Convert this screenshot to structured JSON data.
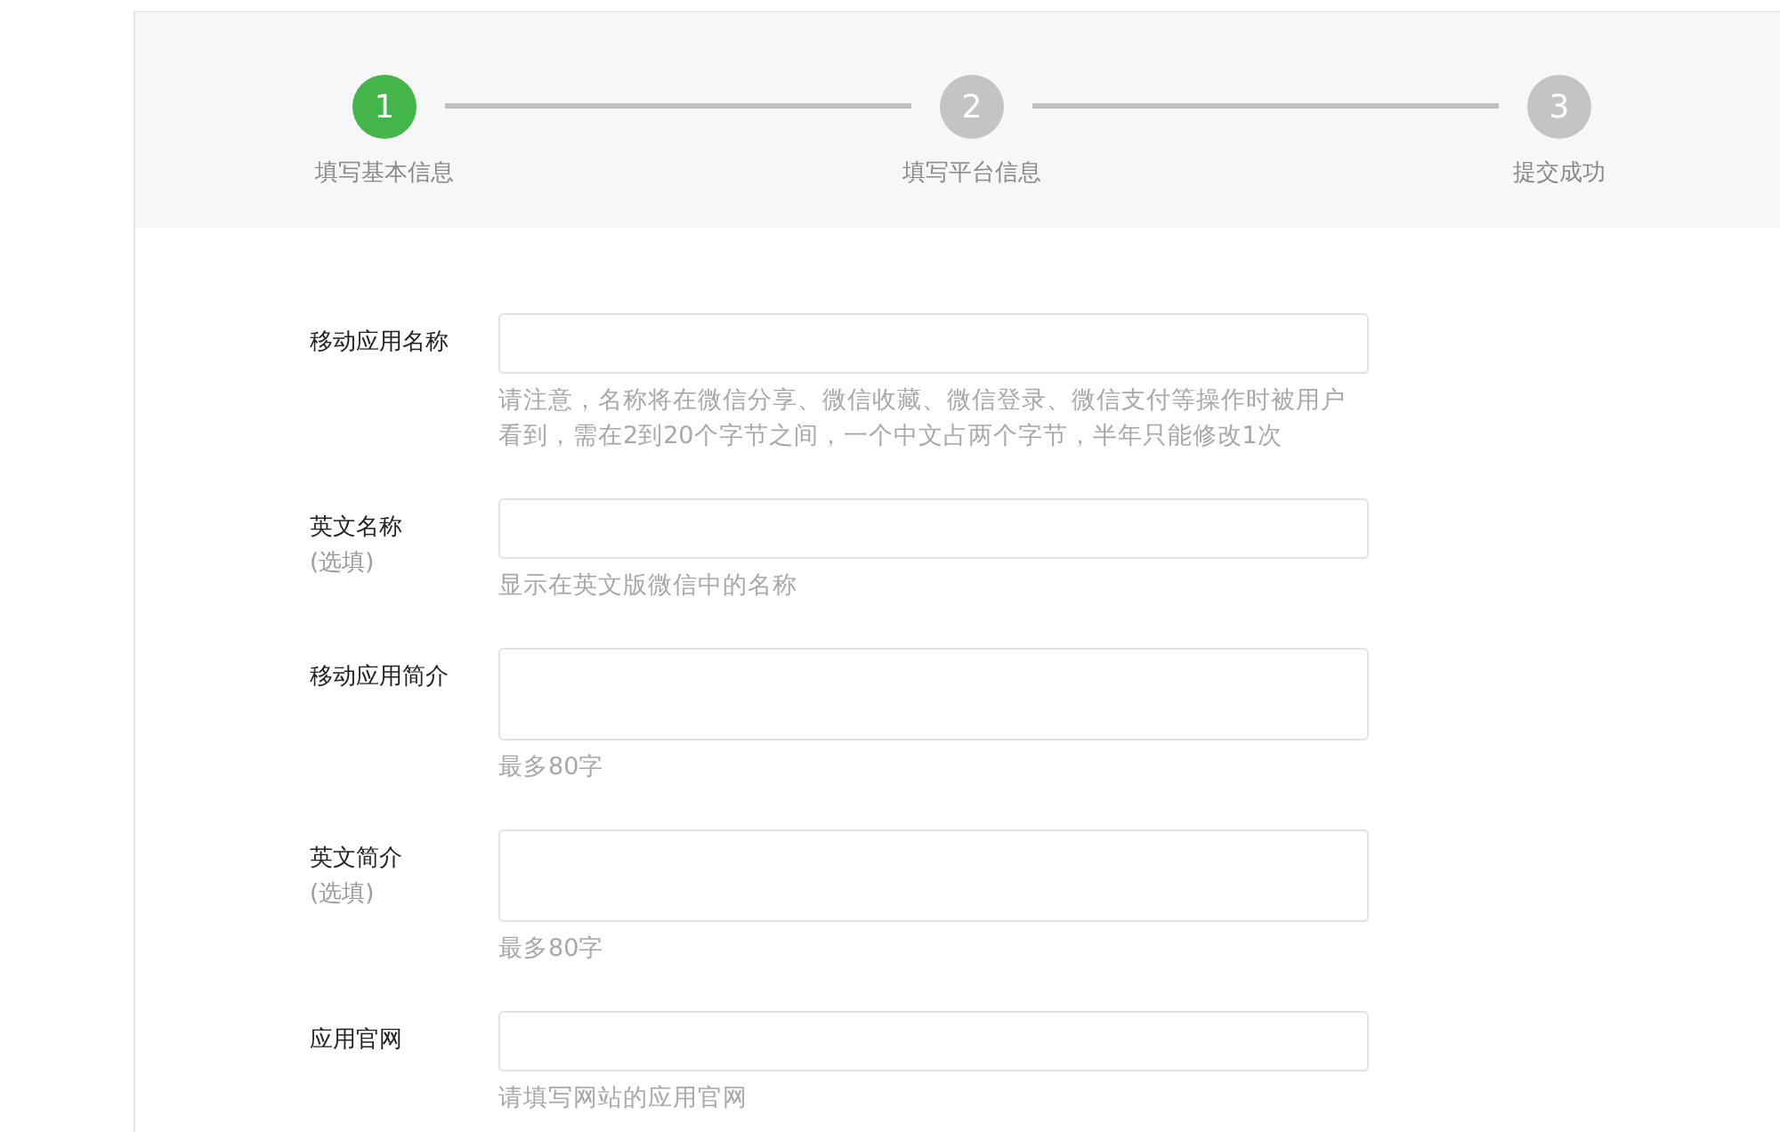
{
  "steps": [
    {
      "number": "1",
      "label": "填写基本信息",
      "active": true
    },
    {
      "number": "2",
      "label": "填写平台信息",
      "active": false
    },
    {
      "number": "3",
      "label": "提交成功",
      "active": false
    }
  ],
  "fields": [
    {
      "kind": "input",
      "label": "移动应用名称",
      "hint": "请注意，名称将在微信分享、微信收藏、微信登录、微信支付等操作时被用户看到，需在2到20个字节之间，一个中文占两个字节，半年只能修改1次"
    },
    {
      "kind": "input",
      "label": "英文名称",
      "optional": "(选填)",
      "hint": "显示在英文版微信中的名称"
    },
    {
      "kind": "textarea",
      "label": "移动应用简介",
      "hint": "最多80字"
    },
    {
      "kind": "textarea",
      "label": "英文简介",
      "optional": "(选填)",
      "hint": "最多80字"
    },
    {
      "kind": "input",
      "label": "应用官网",
      "hint": "请填写网站的应用官网"
    }
  ]
}
